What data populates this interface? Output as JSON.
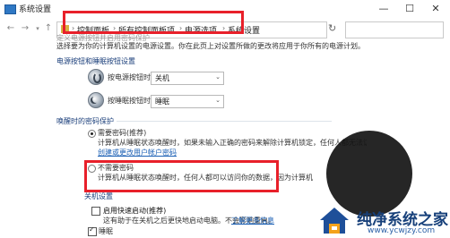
{
  "window": {
    "title": "系统设置",
    "controls": [
      "—",
      "☐",
      "✕"
    ]
  },
  "address": {
    "crumbs": [
      "控制面板",
      "所有控制面板项",
      "电源选项",
      "系统设置"
    ]
  },
  "page": {
    "heading": "定义电源按钮并启用密码保护",
    "intro": "选择要为你的计算机设置的电源设置。你在此页上对设置所做的更改将应用于你所有的电源计划。",
    "power_section": "电源按钮和睡眠按钮设置",
    "power_button_label": "按电源按钮时:",
    "power_button_value": "关机",
    "sleep_button_label": "按睡眠按钮时:",
    "sleep_button_value": "睡眠",
    "password_section": "唤醒时的密码保护",
    "require_password_title": "需要密码(推荐)",
    "require_password_desc1": "计算机从睡眠状态唤醒时，如果未输入正确的密码来解除计算机锁定，任何人都无法访问你的数据。",
    "require_password_link": "创建或更改用户帐户密码",
    "no_password_title": "不需要密码",
    "no_password_desc": "计算机从睡眠状态唤醒时，任何人都可以访问你的数据，因为计算机未锁定。",
    "shutdown_section": "关机设置",
    "fast_startup_title": "启用快速启动(推荐)",
    "fast_startup_desc": "这有助于在关机之后更快地启动电脑。不会影响重启。",
    "learn_more": "了解更多信息",
    "sleep_check": "睡眠"
  },
  "watermark": {
    "title": "纯净系统之家",
    "url": "www.ycwjzy.com"
  },
  "colors": {
    "highlight": "#e8202a",
    "link": "#1a5fb4"
  }
}
